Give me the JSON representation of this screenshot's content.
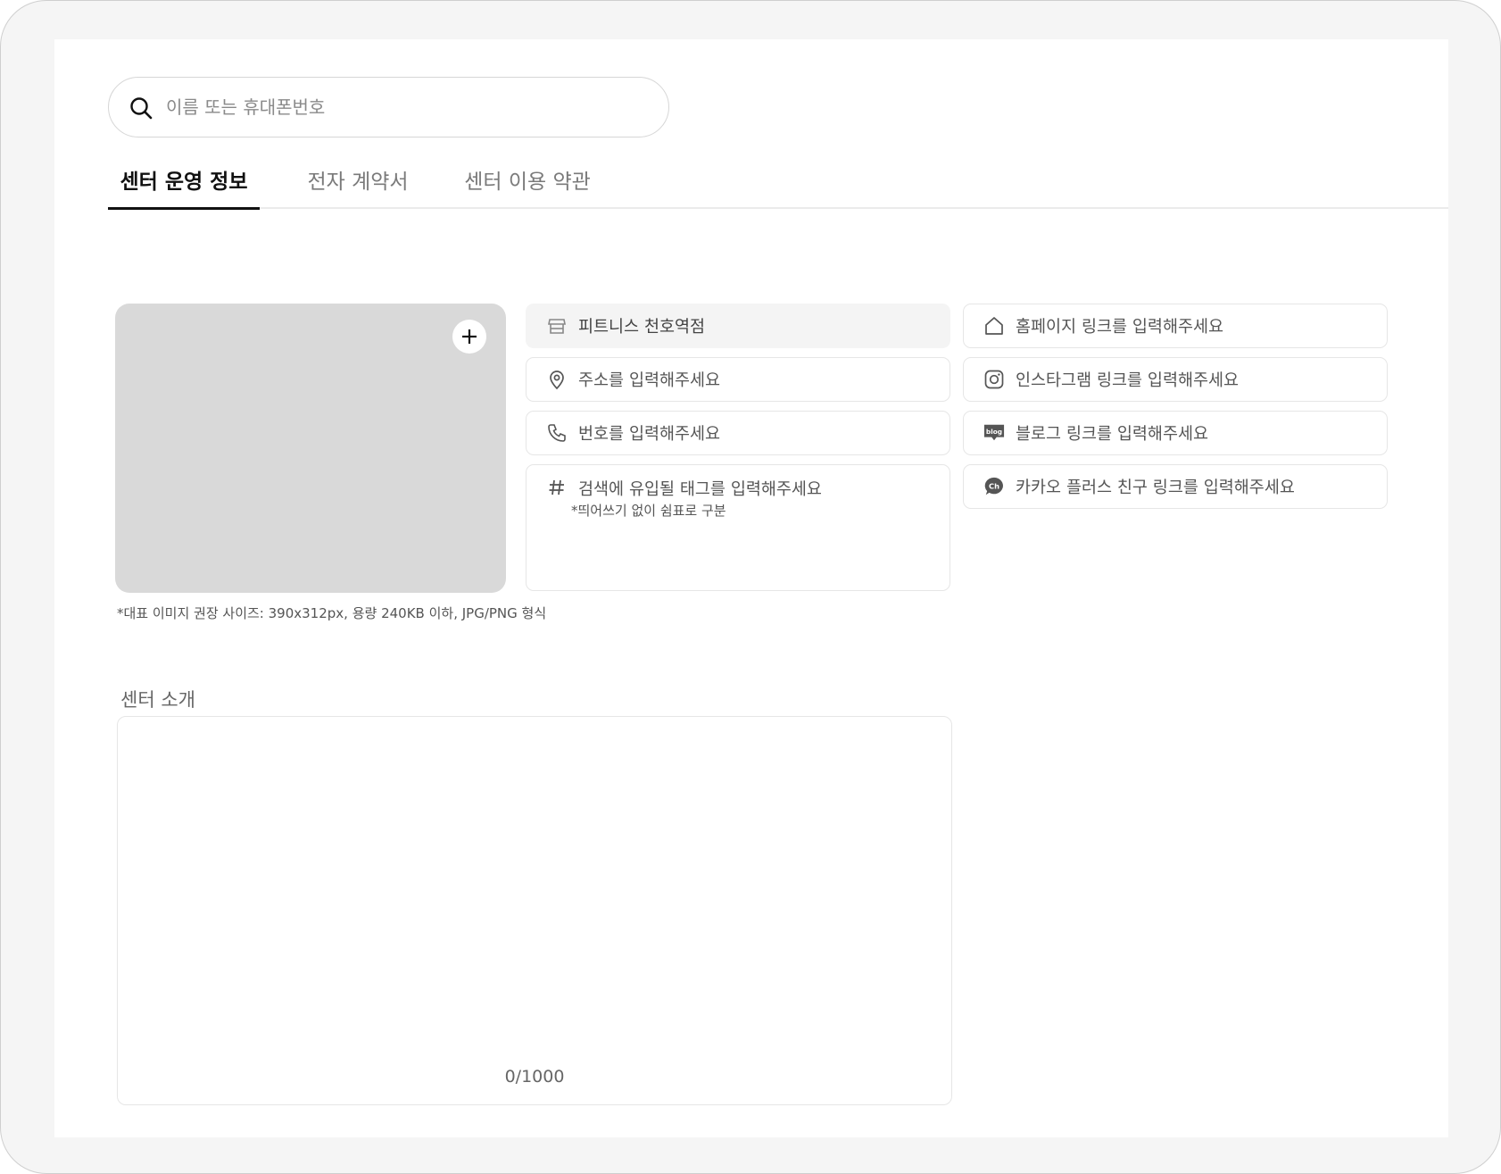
{
  "search": {
    "placeholder": "이름 또는 휴대폰번호"
  },
  "tabs": [
    {
      "label": "센터  운영 정보",
      "active": true
    },
    {
      "label": "전자 계약서",
      "active": false
    },
    {
      "label": "센터 이용 약관",
      "active": false
    }
  ],
  "image_upload": {
    "note": "*대표 이미지 권장 사이즈: 390x312px, 용량 240KB 이하, JPG/PNG 형식"
  },
  "fields_left": {
    "name_value": "피트니스 천호역점",
    "address_placeholder": "주소를 입력해주세요",
    "phone_placeholder": "번호를 입력해주세요",
    "tags_placeholder": "검색에 유입될 태그를 입력해주세요",
    "tags_hint": "*띄어쓰기 없이 쉼표로 구분"
  },
  "fields_right": {
    "homepage_placeholder": "홈페이지 링크를 입력해주세요",
    "instagram_placeholder": "인스타그램 링크를 입력해주세요",
    "blog_placeholder": "블로그 링크를 입력해주세요",
    "blog_badge": "blog",
    "kakao_placeholder": "카카오 플러스 친구 링크를 입력해주세요",
    "kakao_badge": "Ch"
  },
  "intro": {
    "label": "센터 소개",
    "counter": "0/1000"
  },
  "icons": {
    "search": "search-icon",
    "add": "plus-icon",
    "store": "store-icon",
    "location": "location-pin-icon",
    "phone": "phone-icon",
    "hash": "hash-icon",
    "home": "home-icon",
    "instagram": "instagram-icon",
    "blog": "blog-icon",
    "kakao": "kakao-channel-icon"
  },
  "colors": {
    "accent": "#111111",
    "placeholder": "#d9d9d9",
    "filled_field": "#f4f4f4"
  }
}
